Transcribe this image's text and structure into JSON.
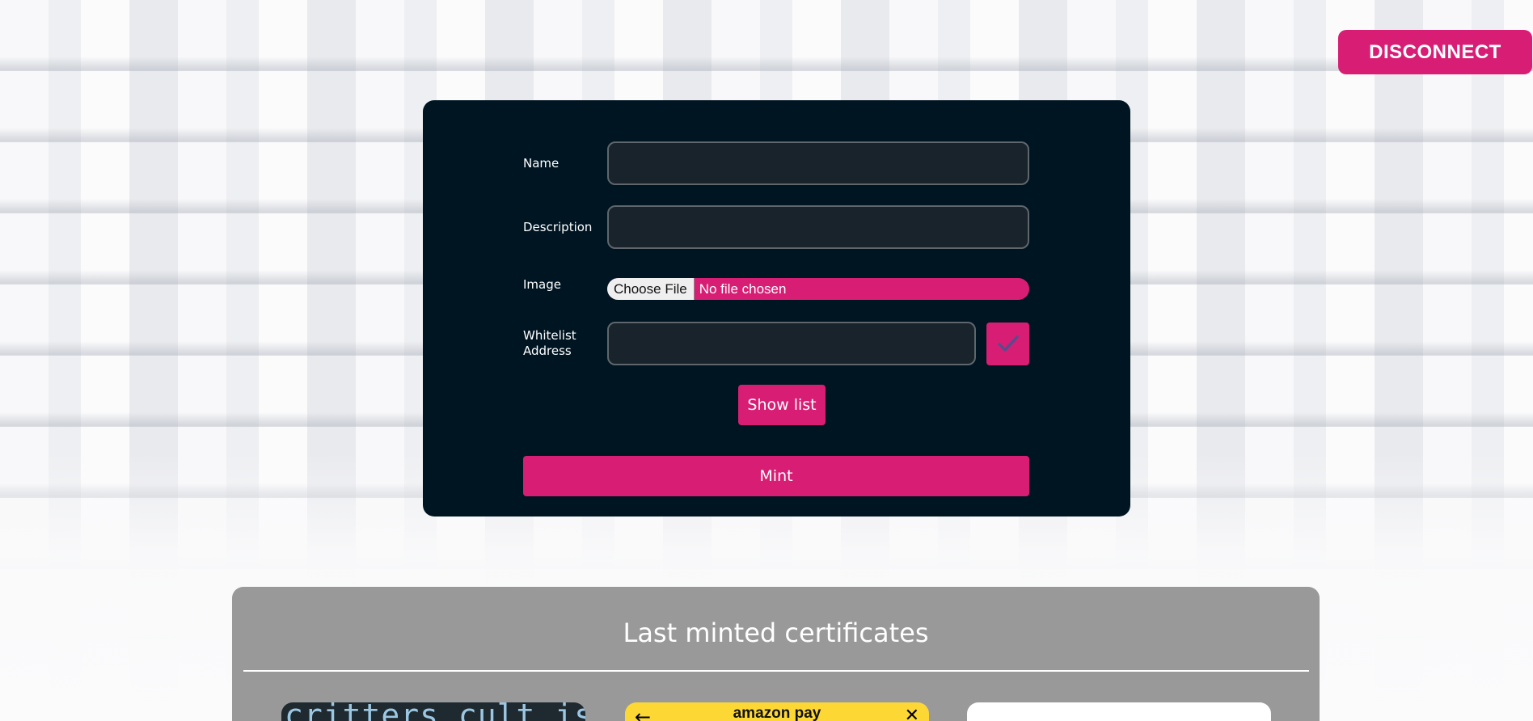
{
  "header": {
    "disconnect_label": "DISCONNECT"
  },
  "form": {
    "name_label": "Name",
    "name_value": "",
    "description_label": "Description",
    "description_value": "",
    "image_label": "Image",
    "choose_file_label": "Choose File",
    "file_status": "No file chosen",
    "whitelist_label_line1": "Whitelist",
    "whitelist_label_line2": "Address",
    "whitelist_value": "",
    "add_icon": "check-icon",
    "show_list_label": "Show list",
    "mint_label": "Mint"
  },
  "certificates": {
    "title": "Last minted certificates",
    "items": [
      {
        "preview_text": "critters cult is"
      },
      {
        "preview_brand": "amazon pay",
        "left_icon": "back-arrow-icon",
        "right_icon": "close-icon"
      },
      {
        "preview_text": ""
      }
    ]
  },
  "colors": {
    "accent": "#d81e74",
    "card_bg": "#001522",
    "panel_bg": "#999999"
  }
}
